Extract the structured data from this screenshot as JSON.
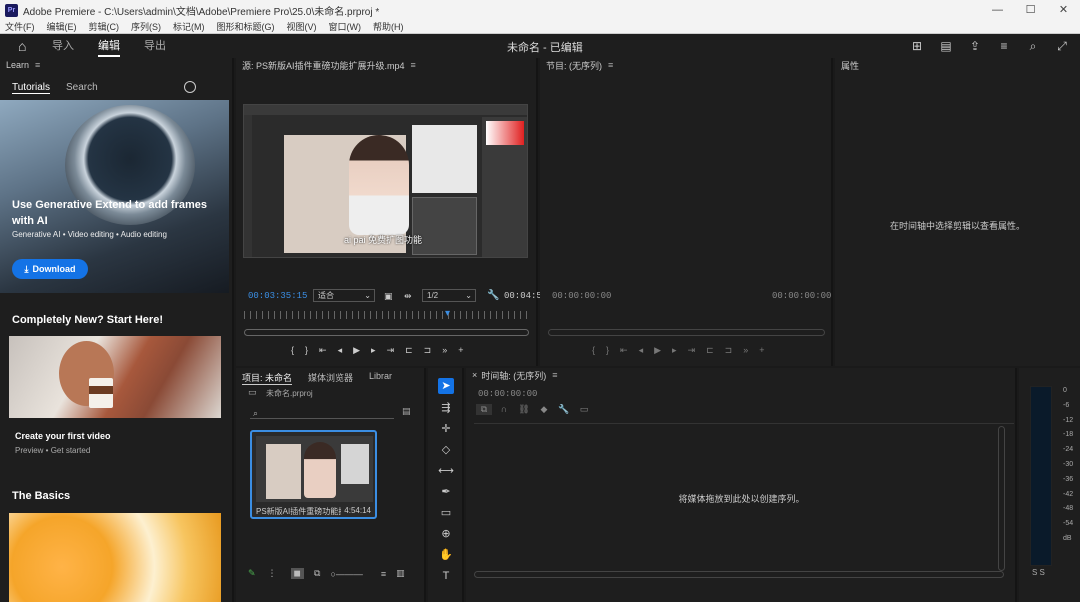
{
  "window": {
    "app_icon": "Pr",
    "title": "Adobe Premiere - C:\\Users\\admin\\文档\\Adobe\\Premiere Pro\\25.0\\未命名.prproj *",
    "controls": [
      "—",
      "☐",
      "✕"
    ]
  },
  "menu": [
    "文件(F)",
    "编辑(E)",
    "剪辑(C)",
    "序列(S)",
    "标记(M)",
    "图形和标题(G)",
    "视图(V)",
    "窗口(W)",
    "帮助(H)"
  ],
  "header": {
    "tabs": [
      "导入",
      "编辑",
      "导出"
    ],
    "active_tab": 1,
    "project_title": "未命名 - 已编辑"
  },
  "learn": {
    "panel_title": "Learn",
    "tabs": [
      "Tutorials",
      "Search"
    ],
    "hero_title": "Use Generative Extend to add frames with AI",
    "hero_sub": "Generative AI • Video editing • Audio editing",
    "download": "Download",
    "section1": "Completely New? Start Here!",
    "card1_title": "Create your first video",
    "card1_sub": "Preview • Get started",
    "section2": "The Basics"
  },
  "source": {
    "panel_title": "源: PS新版AI插件重磅功能扩展升级.mp4",
    "caption": "ai pai 免费扩图功能",
    "timecode": "00:03:35:15",
    "fit": "适合",
    "quality": "1/2",
    "duration": "00:04:5"
  },
  "program": {
    "panel_title": "节目: (无序列)",
    "tc_left": "00:00:00:00",
    "tc_right": "00:00:00:00"
  },
  "properties": {
    "panel_title": "属性",
    "empty": "在时间轴中选择剪辑以查看属性。"
  },
  "project": {
    "tabs": [
      "项目: 未命名",
      "媒体浏览器",
      "Librar"
    ],
    "path": "未命名.prproj",
    "clip_name": "PS新版AI插件重磅功能扩展",
    "clip_duration": "4:54:14"
  },
  "timeline": {
    "panel_title": "时间轴: (无序列)",
    "timecode": "00:00:00:00",
    "empty": "将媒体拖放到此处以创建序列。"
  },
  "meter": {
    "scale": [
      "0",
      "-6",
      "-12",
      "-18",
      "-24",
      "-30",
      "-36",
      "-42",
      "-48",
      "-54",
      "dB"
    ],
    "solo": "S S"
  }
}
